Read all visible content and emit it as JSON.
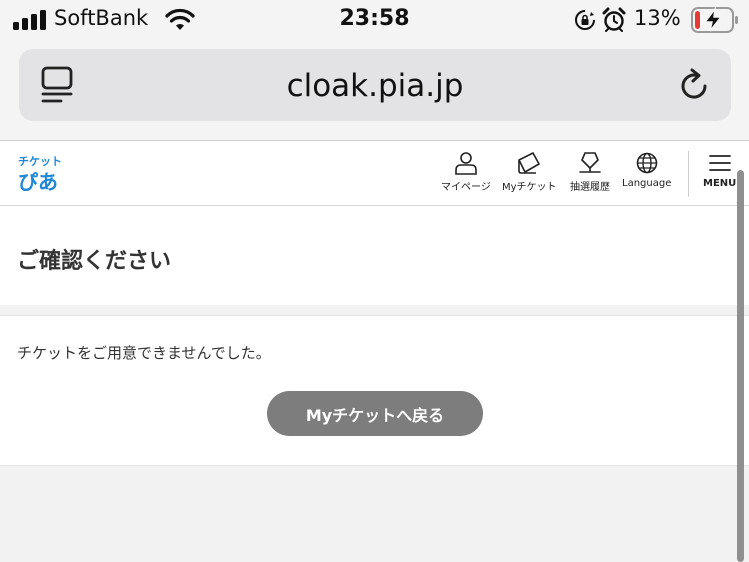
{
  "status_bar": {
    "carrier": "SoftBank",
    "time": "23:58",
    "battery_percent": "13%",
    "battery_level": 0.13,
    "battery_color": "#e53935"
  },
  "browser": {
    "url": "cloak.pia.jp"
  },
  "header": {
    "logo_text_top": "チケット",
    "logo_text_bottom": "ぴあ",
    "nav": {
      "mypage": "マイページ",
      "myticket": "Myチケット",
      "lottery": "抽選履歴",
      "language": "Language",
      "menu": "MENU"
    }
  },
  "main": {
    "title": "ご確認ください",
    "message": "チケットをご用意できませんでした。",
    "back_button": "Myチケットへ戻る"
  },
  "colors": {
    "button_bg": "#7d7d7d",
    "logo_blue": "#1e88d6"
  }
}
